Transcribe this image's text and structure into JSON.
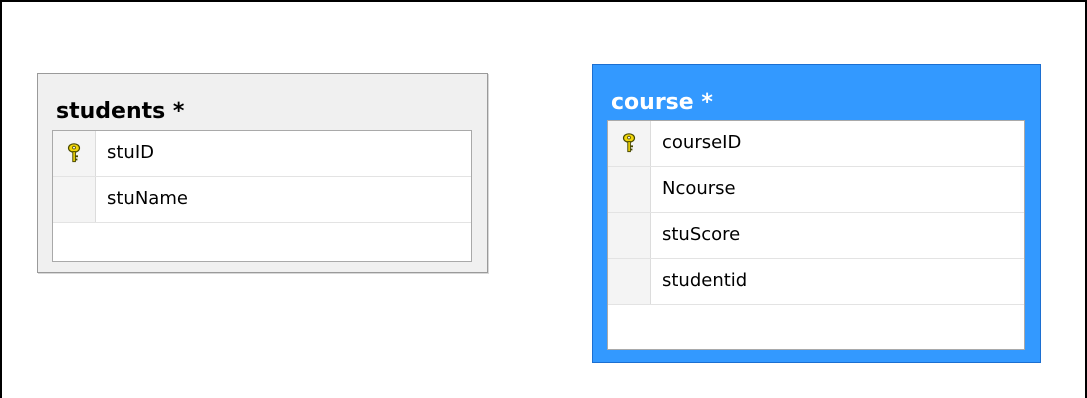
{
  "students": {
    "title": "students *",
    "columns": [
      {
        "name": "stuID",
        "primary_key": true
      },
      {
        "name": "stuName",
        "primary_key": false
      }
    ]
  },
  "course": {
    "title": "course *",
    "columns": [
      {
        "name": "courseID",
        "primary_key": true
      },
      {
        "name": "Ncourse",
        "primary_key": false
      },
      {
        "name": "stuScore",
        "primary_key": false
      },
      {
        "name": "studentid",
        "primary_key": false
      }
    ]
  },
  "colors": {
    "selected_table": "#3399ff",
    "unselected_table": "#f0f0f0",
    "key_icon": "#f2d60a"
  }
}
